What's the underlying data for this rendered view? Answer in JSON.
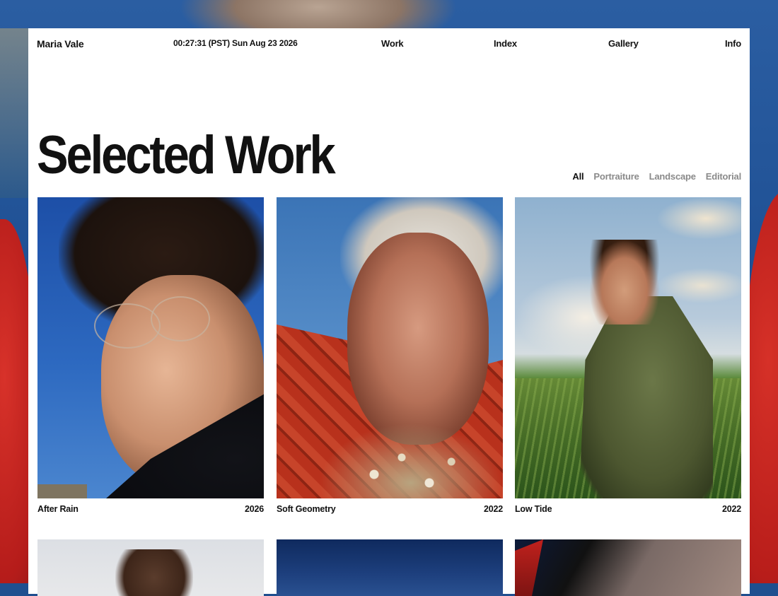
{
  "nav": {
    "brand": "Maria Vale",
    "clock": "00:27:31 (PST) Sun Aug 23 2026",
    "links": [
      "Work",
      "Index",
      "Gallery",
      "Info"
    ]
  },
  "page": {
    "title": "Selected Work"
  },
  "filters": {
    "items": [
      "All",
      "Portraiture",
      "Landscape",
      "Editorial"
    ],
    "active": "All"
  },
  "works": [
    {
      "title": "After Rain",
      "year": "2026"
    },
    {
      "title": "Soft Geometry",
      "year": "2022"
    },
    {
      "title": "Low Tide",
      "year": "2022"
    }
  ],
  "colors": {
    "page_bg": "#ffffff",
    "text": "#111111",
    "filter_inactive": "#8a8a8a"
  }
}
